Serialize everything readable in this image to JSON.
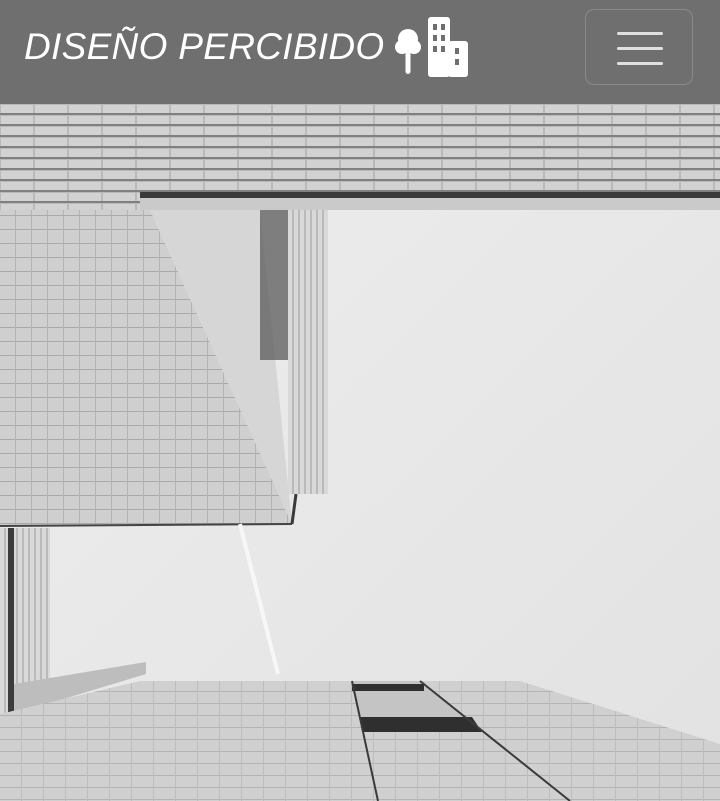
{
  "navbar": {
    "brand_text": "DISEÑO PERCIBIDO",
    "brand_icon": "tree-and-building-icon",
    "menu_icon": "hamburger-menu-icon"
  },
  "hero": {
    "image": "black-and-white upward view of modern building facades against sky"
  },
  "colors": {
    "navbar_bg": "#6f6f6f",
    "brand_text": "#ffffff"
  }
}
